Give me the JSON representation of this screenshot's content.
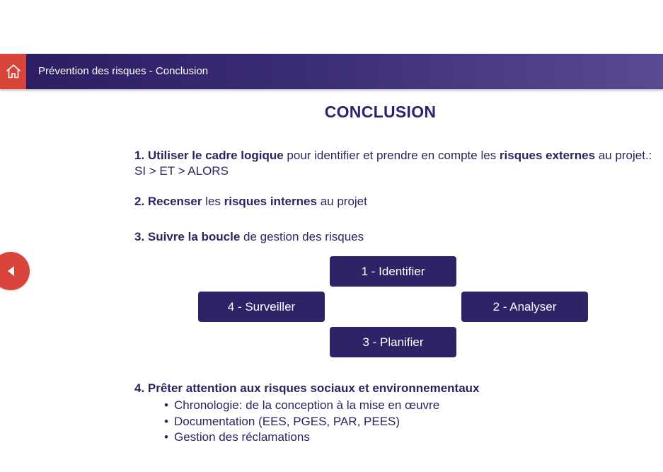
{
  "header": {
    "title": "Prévention des risques - Conclusion",
    "home_icon": "home-icon",
    "accent_color": "#d9443a"
  },
  "main": {
    "heading": "CONCLUSION",
    "point1": {
      "bold_a": "1. Utiliser le cadre logique",
      "text_a": " pour identifier et prendre en compte les ",
      "bold_b": "risques externes",
      "text_b": " au projet.: SI > ET > ALORS"
    },
    "point2": {
      "bold_a": "2. Recenser",
      "text_a": " les ",
      "bold_b": "risques internes",
      "text_b": " au projet"
    },
    "point3": {
      "bold_a": "3. Suivre la boucle",
      "text_a": " de gestion des risques"
    },
    "loop_steps": {
      "identify": "1 - Identifier",
      "analyse": "2 - Analyser",
      "plan": "3 - Planifier",
      "monitor": "4 - Surveiller"
    },
    "point4": {
      "bold_a": "4. Prêter attention aux risques sociaux et environnementaux"
    },
    "bullets": [
      "Chronologie: de la conception à la mise en œuvre",
      "Documentation (EES, PGES, PAR, PEES)",
      "Gestion des réclamations"
    ]
  },
  "navigation": {
    "prev_icon": "arrow-left-icon",
    "button_color": "#2f2266"
  }
}
